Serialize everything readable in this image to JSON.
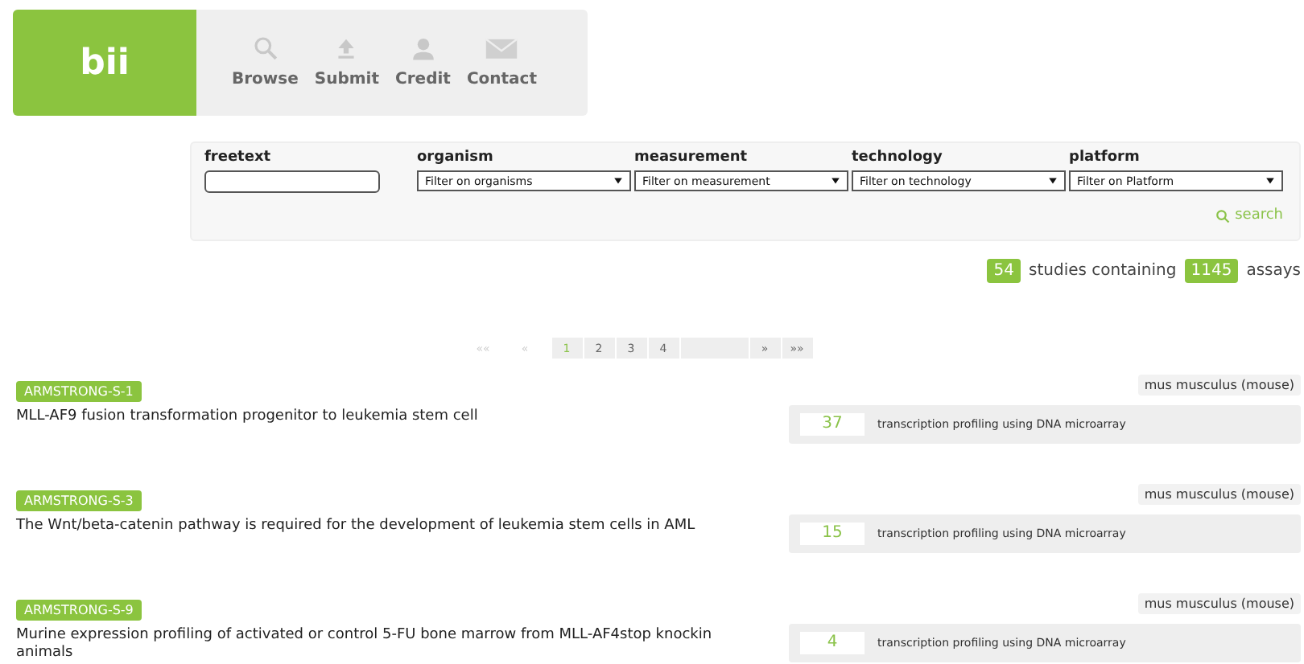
{
  "logo": "bii",
  "nav": [
    {
      "label": "Browse"
    },
    {
      "label": "Submit"
    },
    {
      "label": "Credit"
    },
    {
      "label": "Contact"
    }
  ],
  "filters": {
    "freetext": {
      "label": "freetext"
    },
    "selects": [
      {
        "label": "organism",
        "value": "Filter on organisms"
      },
      {
        "label": "measurement",
        "value": "Filter on measurement"
      },
      {
        "label": "technology",
        "value": "Filter on technology"
      },
      {
        "label": "platform",
        "value": "Filter on Platform"
      }
    ],
    "search": "search"
  },
  "summary": {
    "studies": "54",
    "studies_text": "studies containing",
    "assays": "1145",
    "assays_text": "assays"
  },
  "pagination": [
    {
      "label": "««",
      "selected": false,
      "disabled": true
    },
    {
      "label": "«",
      "selected": false,
      "disabled": true
    },
    {
      "label": "1",
      "selected": true,
      "disabled": false
    },
    {
      "label": "2",
      "selected": false,
      "disabled": false
    },
    {
      "label": "3",
      "selected": false,
      "disabled": false
    },
    {
      "label": "4",
      "selected": false,
      "disabled": false
    },
    {
      "label": "»",
      "selected": false,
      "disabled": false
    },
    {
      "label": "»»",
      "selected": false,
      "disabled": false
    }
  ],
  "studies": [
    {
      "id": "ARMSTRONG-S-1",
      "organism": "mus musculus (mouse)",
      "title": "MLL-AF9 fusion transformation progenitor to leukemia stem cell",
      "assay_count": "37",
      "assay_type": "transcription profiling using DNA microarray"
    },
    {
      "id": "ARMSTRONG-S-3",
      "organism": "mus musculus (mouse)",
      "title": "The Wnt/beta-catenin pathway is required for the development of leukemia stem cells in AML",
      "assay_count": "15",
      "assay_type": "transcription profiling using DNA microarray"
    },
    {
      "id": "ARMSTRONG-S-9",
      "organism": "mus musculus (mouse)",
      "title": "Murine expression profiling of activated or control 5-FU bone marrow from MLL-AF4stop knockin animals",
      "assay_count": "4",
      "assay_type": "transcription profiling using DNA microarray"
    }
  ]
}
